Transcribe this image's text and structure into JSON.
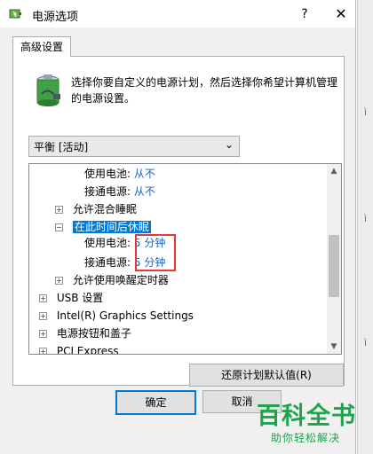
{
  "window": {
    "title": "电源选项",
    "help_label": "?",
    "close_label": "✕"
  },
  "tab": {
    "label": "高级设置"
  },
  "description": "选择你要自定义的电源计划，然后选择你希望计算机管理的电源设置。",
  "plan_select": {
    "value": "平衡 [活动]"
  },
  "tree": {
    "rows": [
      {
        "label": "使用电池:",
        "value": "从不"
      },
      {
        "label": "接通电源:",
        "value": "从不"
      },
      {
        "label": "允许混合睡眠"
      },
      {
        "label": "在此时间后休眠"
      },
      {
        "label": "使用电池:",
        "value": "5 分钟"
      },
      {
        "label": "接通电源:",
        "value": "5 分钟"
      },
      {
        "label": "允许使用唤醒定时器"
      },
      {
        "label": "USB 设置"
      },
      {
        "label": "Intel(R) Graphics Settings"
      },
      {
        "label": "电源按钮和盖子"
      },
      {
        "label": "PCI Express"
      }
    ],
    "expander_collapsed": "+",
    "expander_expanded": "−"
  },
  "buttons": {
    "restore": "还原计划默认值(R)",
    "ok": "确定",
    "cancel": "取消"
  },
  "watermark": {
    "title": "百科全书",
    "subtitle": "助你轻松解决"
  },
  "icons": {
    "title_icon": "power-options-icon",
    "battery_icon": "battery-plug-icon"
  },
  "colors": {
    "link": "#1a63c7",
    "selection": "#0078d7",
    "highlight": "#e53935",
    "watermark": "#1fa44e"
  }
}
